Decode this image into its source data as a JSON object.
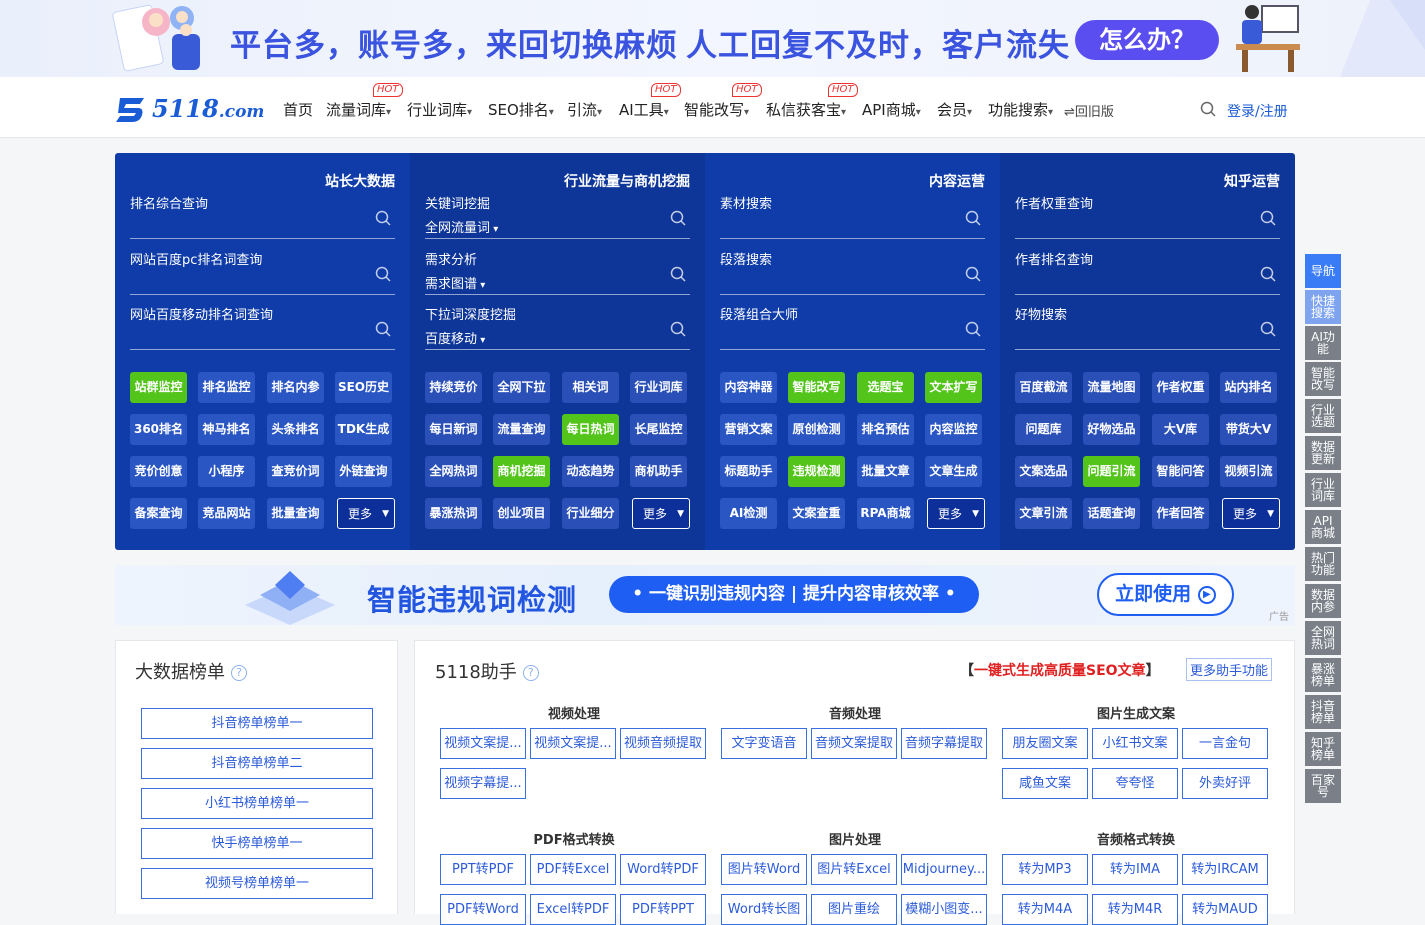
{
  "top_banner": {
    "slogan_left": "平台多，账号多，来回切换麻烦",
    "slogan_right": "人工回复不及时，客户流失",
    "button": "怎么办？"
  },
  "header": {
    "logo": {
      "main": "5118",
      "suffix": ".com"
    },
    "nav": [
      "首页",
      "流量词库",
      "行业词库",
      "SEO排名",
      "引流",
      "AI工具",
      "智能改写",
      "私信获客宝",
      "API商城",
      "会员",
      "功能搜索"
    ],
    "hot_badge": "HOT",
    "old_version": "⇌回旧版",
    "login": "登录/注册"
  },
  "panel": {
    "columns": [
      {
        "title": "站长大数据",
        "color": "#0f3ca8",
        "queries": [
          {
            "label": "排名综合查询"
          },
          {
            "label": "网站百度pc排名词查询"
          },
          {
            "label": "网站百度移动排名词查询"
          }
        ],
        "tags": [
          "站群监控",
          "排名监控",
          "排名内参",
          "SEO历史",
          "360排名",
          "神马排名",
          "头条排名",
          "TDK生成",
          "竞价创意",
          "小程序",
          "查竞价词",
          "外链查询",
          "备案查询",
          "竞品网站",
          "批量查询"
        ],
        "green": [
          "站群监控"
        ]
      },
      {
        "title": "行业流量与商机挖掘",
        "color": "#0e3598",
        "queries": [
          {
            "label": "关键词挖掘",
            "select": "全网流量词"
          },
          {
            "label": "需求分析",
            "select": "需求图谱"
          },
          {
            "label": "下拉词深度挖掘",
            "select": "百度移动"
          }
        ],
        "tags": [
          "持续竞价",
          "全网下拉",
          "相关词",
          "行业词库",
          "每日新词",
          "流量查询",
          "每日热词",
          "长尾监控",
          "全网热词",
          "商机挖掘",
          "动态趋势",
          "商机助手",
          "暴涨热词",
          "创业项目",
          "行业细分"
        ],
        "green": [
          "每日热词",
          "商机挖掘"
        ]
      },
      {
        "title": "内容运营",
        "color": "#0f3ca8",
        "queries": [
          {
            "label": "素材搜索"
          },
          {
            "label": "段落搜索"
          },
          {
            "label": "段落组合大师"
          }
        ],
        "tags": [
          "内容神器",
          "智能改写",
          "选题宝",
          "文本扩写",
          "营销文案",
          "原创检测",
          "排名预估",
          "内容监控",
          "标题助手",
          "违规检测",
          "批量文章",
          "文章生成",
          "AI检测",
          "文案查重",
          "RPA商城"
        ],
        "green": [
          "智能改写",
          "选题宝",
          "文本扩写",
          "违规检测"
        ]
      },
      {
        "title": "知乎运营",
        "color": "#0e3598",
        "queries": [
          {
            "label": "作者权重查询"
          },
          {
            "label": "作者排名查询"
          },
          {
            "label": "好物搜索"
          }
        ],
        "tags": [
          "百度截流",
          "流量地图",
          "作者权重",
          "站内排名",
          "问题库",
          "好物选品",
          "大V库",
          "带货大V",
          "文案选品",
          "问题引流",
          "智能问答",
          "视频引流",
          "文章引流",
          "话题查询",
          "作者回答"
        ],
        "green": [
          "问题引流"
        ]
      }
    ],
    "more_label": "更多"
  },
  "ad_banner": {
    "title": "智能违规词检测",
    "pill": "• 一键识别违规内容 | 提升内容审核效率 •",
    "button": "立即使用",
    "ad": "广告"
  },
  "sidebar": [
    "导航",
    "快捷搜索",
    "AI功能",
    "智能改写",
    "行业选题",
    "数据更新",
    "行业词库",
    "API商城",
    "热门功能",
    "数据内参",
    "全网热词",
    "暴涨榜单",
    "抖音榜单",
    "知乎榜单",
    "百家号"
  ],
  "big_data": {
    "title": "大数据榜单",
    "items": [
      "抖音榜单榜单一",
      "抖音榜单榜单二",
      "小红书榜单榜单一",
      "快手榜单榜单一",
      "视频号榜单榜单一"
    ]
  },
  "assistant": {
    "title": "5118助手",
    "promo_prefix": "【",
    "promo": "一键式生成高质量SEO文章",
    "promo_suffix": "】",
    "more": "更多助手功能",
    "sections": [
      {
        "name": "视频处理",
        "items": [
          "视频文案提...",
          "视频文案提...",
          "视频音频提取",
          "视频字幕提..."
        ]
      },
      {
        "name": "音频处理",
        "items": [
          "文字变语音",
          "音频文案提取",
          "音频字幕提取"
        ]
      },
      {
        "name": "图片生成文案",
        "items": [
          "朋友圈文案",
          "小红书文案",
          "一言金句",
          "咸鱼文案",
          "夸夸怪",
          "外卖好评"
        ]
      },
      {
        "name": "PDF格式转换",
        "items": [
          "PPT转PDF",
          "PDF转Excel",
          "Word转PDF",
          "PDF转Word",
          "Excel转PDF",
          "PDF转PPT"
        ]
      },
      {
        "name": "图片处理",
        "items": [
          "图片转Word",
          "图片转Excel",
          "Midjourney...",
          "Word转长图",
          "图片重绘",
          "模糊小图变..."
        ]
      },
      {
        "name": "音频格式转换",
        "items": [
          "转为MP3",
          "转为IMA",
          "转为IRCAM",
          "转为M4A",
          "转为M4R",
          "转为MAUD"
        ]
      }
    ]
  }
}
